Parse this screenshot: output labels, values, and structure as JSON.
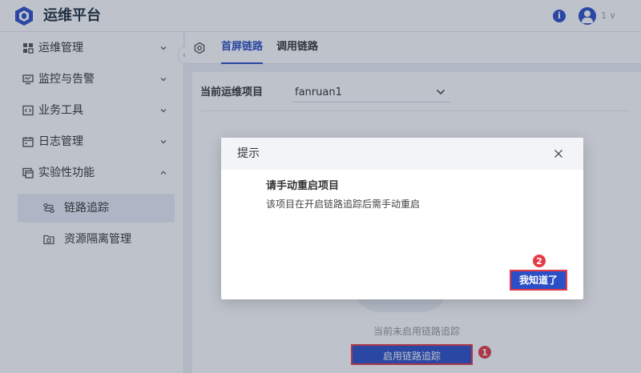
{
  "header": {
    "app_title": "运维平台",
    "user_caret": "1 ∨"
  },
  "sidebar": {
    "items": [
      {
        "label": "运维管理",
        "icon": "grid-icon",
        "expanded": false
      },
      {
        "label": "监控与告警",
        "icon": "monitor-icon",
        "expanded": false
      },
      {
        "label": "业务工具",
        "icon": "code-icon",
        "expanded": false
      },
      {
        "label": "日志管理",
        "icon": "calendar-icon",
        "expanded": false
      },
      {
        "label": "实验性功能",
        "icon": "window-icon",
        "expanded": true
      }
    ],
    "sub_items": [
      {
        "label": "链路追踪",
        "icon": "trace-icon",
        "active": true
      },
      {
        "label": "资源隔离管理",
        "icon": "folder-icon",
        "active": false
      }
    ],
    "collapse_glyph": "‹"
  },
  "tabs": [
    {
      "label": "首屏链路",
      "active": true
    },
    {
      "label": "调用链路",
      "active": false
    }
  ],
  "content": {
    "project_label": "当前运维项目",
    "project_value": "fanruan1",
    "empty_text": "当前未启用链路追踪",
    "enable_button": "启用链路追踪"
  },
  "dialog": {
    "title": "提示",
    "heading": "请手动重启项目",
    "message": "该项目在开启链路追踪后需手动重启",
    "ok_button": "我知道了"
  },
  "info_glyph": "i",
  "markers": [
    "1",
    "2"
  ],
  "colors": {
    "primary": "#2b4fc7",
    "highlight": "#e53945"
  }
}
